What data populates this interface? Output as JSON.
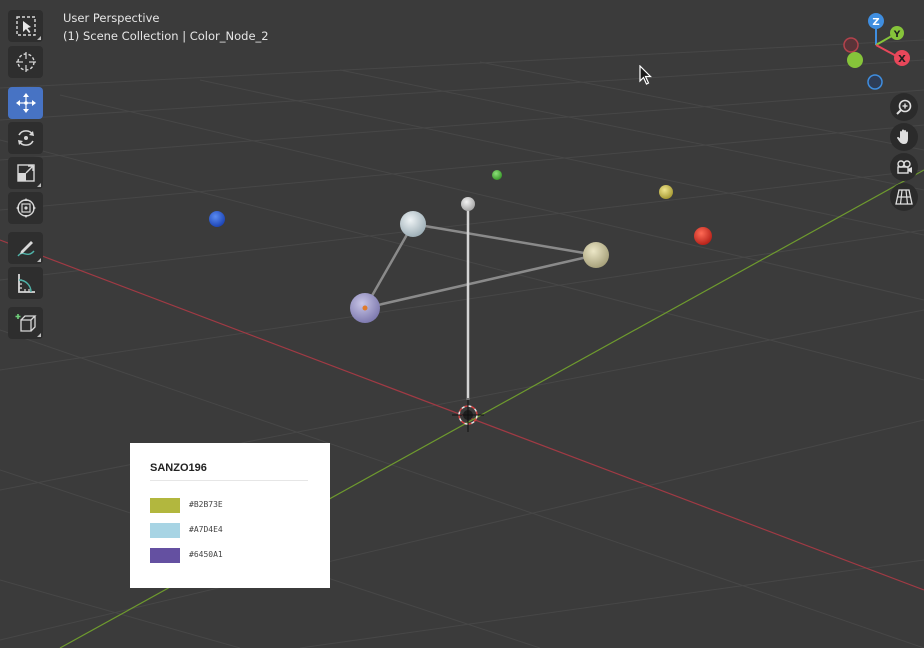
{
  "viewport": {
    "mode_label": "User Perspective",
    "scene_label": "(1) Scene Collection | Color_Node_2"
  },
  "toolbar": {
    "tools": [
      {
        "name": "select-box",
        "icon": "select-box-icon",
        "active": false
      },
      {
        "name": "cursor",
        "icon": "cursor-target-icon",
        "active": false
      },
      {
        "name": "move",
        "icon": "move-arrows-icon",
        "active": true
      },
      {
        "name": "rotate",
        "icon": "rotate-icon",
        "active": false
      },
      {
        "name": "scale",
        "icon": "scale-icon",
        "active": false
      },
      {
        "name": "transform",
        "icon": "transform-icon",
        "active": false
      },
      {
        "name": "annotate",
        "icon": "annotate-pen-icon",
        "active": false
      },
      {
        "name": "measure",
        "icon": "measure-ruler-icon",
        "active": false
      },
      {
        "name": "add-cube",
        "icon": "add-cube-icon",
        "active": false
      }
    ]
  },
  "navigation": {
    "axes": {
      "x": "X",
      "y": "Y",
      "z": "Z"
    },
    "buttons": [
      "zoom-icon",
      "hand-pan-icon",
      "camera-icon",
      "grid-perspective-icon"
    ],
    "colors": {
      "x": "#e8475a",
      "y": "#86c43a",
      "z": "#3f8ee0"
    }
  },
  "scene": {
    "colors": {
      "grid": "#4a4a4a",
      "x_axis": "#b4424c",
      "y_axis": "#6e9a2e",
      "node_blue": "#2b5fd6",
      "node_green": "#58c443",
      "node_yellow": "#cfc35a",
      "node_red": "#e0392a",
      "node_light_blue": "#c4d4dc",
      "node_cream": "#cfc9a3",
      "node_purple": "#a7a3d0",
      "node_small_gray": "#cfcfcf"
    }
  },
  "palette": {
    "title": "SANZO196",
    "swatches": [
      {
        "hex": "#B2B73E",
        "color": "#B2B73E"
      },
      {
        "hex": "#A7D4E4",
        "color": "#A7D4E4"
      },
      {
        "hex": "#6450A1",
        "color": "#6450A1"
      }
    ]
  }
}
